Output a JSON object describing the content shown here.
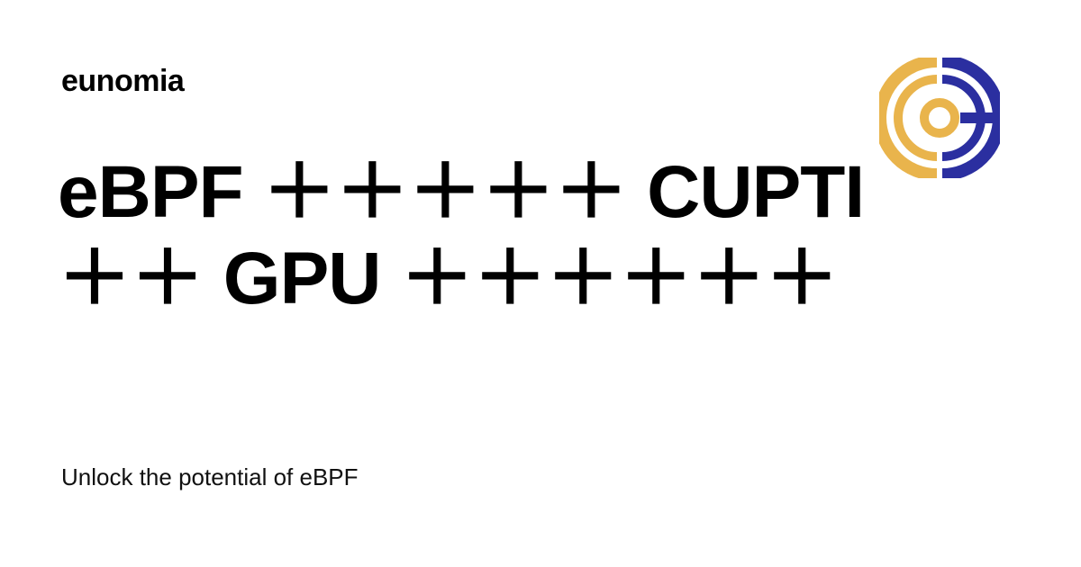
{
  "site": {
    "name": "eunomia"
  },
  "article": {
    "title_line_1": "eBPF ＋＋＋＋＋ CUPTI",
    "title_line_2": "＋＋ GPU ＋＋＋＋＋＋",
    "tagline": "Unlock the potential of eBPF"
  },
  "logo": {
    "icon": "eunomia-logo-icon",
    "color_left": "#E9B44C",
    "color_right": "#2B2FA0"
  }
}
